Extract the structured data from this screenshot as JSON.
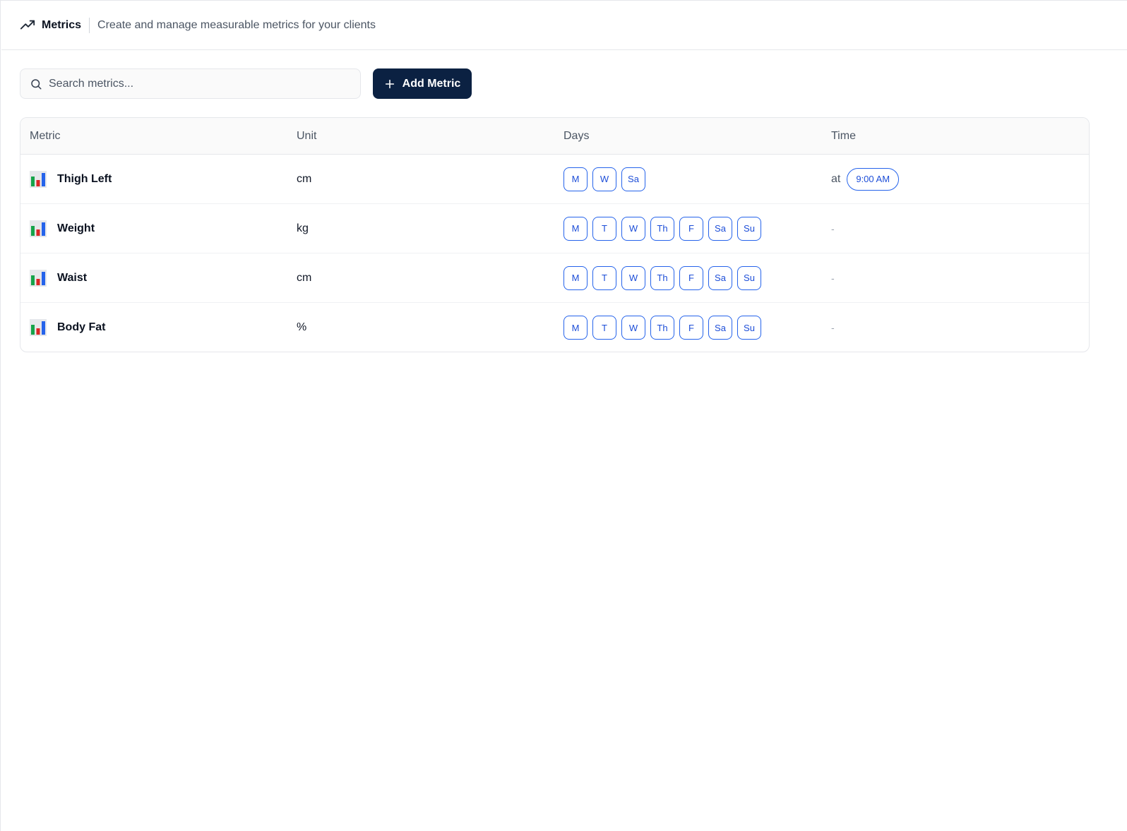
{
  "header": {
    "title": "Metrics",
    "subtitle": "Create and manage measurable metrics for your clients",
    "icon": "trending-up-icon"
  },
  "search": {
    "placeholder": "Search metrics...",
    "value": ""
  },
  "toolbar": {
    "add_label": "Add Metric"
  },
  "table": {
    "columns": [
      "Metric",
      "Unit",
      "Days",
      "Time"
    ],
    "rows": [
      {
        "name": "Thigh Left",
        "unit": "cm",
        "days": [
          "M",
          "W",
          "Sa"
        ],
        "time_prefix": "at",
        "time": "9:00 AM"
      },
      {
        "name": "Weight",
        "unit": "kg",
        "days": [
          "M",
          "T",
          "W",
          "Th",
          "F",
          "Sa",
          "Su"
        ],
        "time": "-"
      },
      {
        "name": "Waist",
        "unit": "cm",
        "days": [
          "M",
          "T",
          "W",
          "Th",
          "F",
          "Sa",
          "Su"
        ],
        "time": "-"
      },
      {
        "name": "Body Fat",
        "unit": "%",
        "days": [
          "M",
          "T",
          "W",
          "Th",
          "F",
          "Sa",
          "Su"
        ],
        "time": "-"
      }
    ]
  },
  "colors": {
    "primary_button": "#0b2142",
    "accent_blue": "#2563eb"
  }
}
